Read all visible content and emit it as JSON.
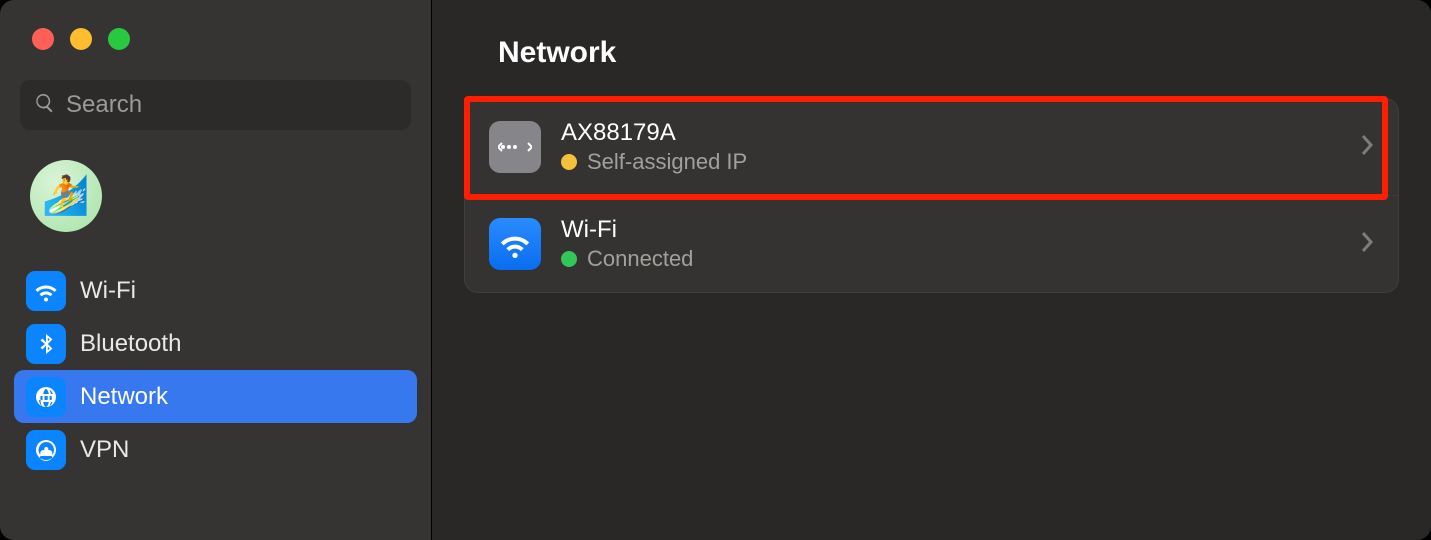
{
  "search": {
    "placeholder": "Search"
  },
  "sidebar": {
    "items": [
      {
        "label": "Wi-Fi"
      },
      {
        "label": "Bluetooth"
      },
      {
        "label": "Network"
      },
      {
        "label": "VPN"
      }
    ]
  },
  "page": {
    "title": "Network"
  },
  "interfaces": [
    {
      "name": "AX88179A",
      "status": "Self-assigned IP",
      "status_color": "yellow",
      "icon": "ethernet"
    },
    {
      "name": "Wi-Fi",
      "status": "Connected",
      "status_color": "green",
      "icon": "wifi"
    }
  ]
}
